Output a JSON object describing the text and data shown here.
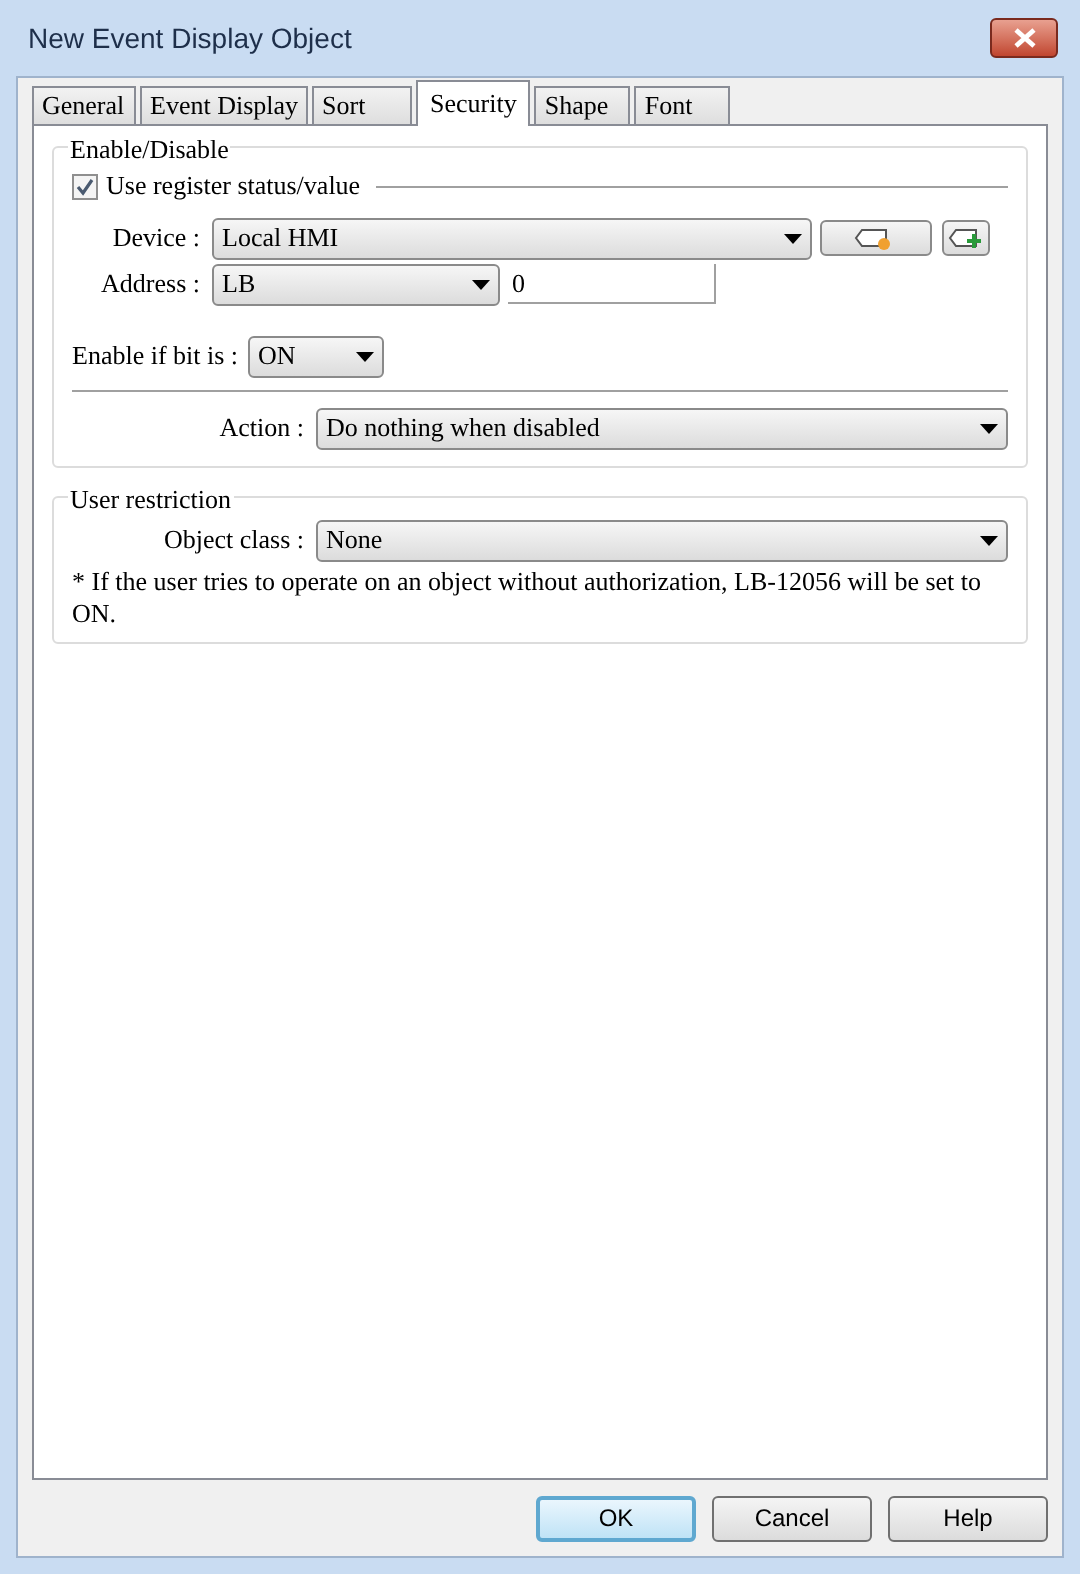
{
  "window": {
    "title": "New Event Display Object"
  },
  "tabs": [
    {
      "label": "General",
      "selected": false
    },
    {
      "label": "Event Display",
      "selected": false
    },
    {
      "label": "Sort",
      "selected": false
    },
    {
      "label": "Security",
      "selected": true
    },
    {
      "label": "Shape",
      "selected": false
    },
    {
      "label": "Font",
      "selected": false
    }
  ],
  "enable_disable": {
    "title": "Enable/Disable",
    "use_register": {
      "label": "Use register status/value",
      "checked": true
    },
    "device": {
      "label": "Device :",
      "value": "Local HMI"
    },
    "address": {
      "label": "Address :",
      "value": "LB",
      "number": "0"
    },
    "enable_if_bit": {
      "label": "Enable if bit is :",
      "value": "ON"
    },
    "action": {
      "label": "Action :",
      "value": "Do nothing when disabled"
    }
  },
  "user_restriction": {
    "title": "User restriction",
    "object_class": {
      "label": "Object class :",
      "value": "None"
    },
    "note": "* If the user tries to operate on an object without authorization, LB-12056 will be set to ON."
  },
  "buttons": [
    {
      "label": "OK",
      "default": true
    },
    {
      "label": "Cancel",
      "default": false
    },
    {
      "label": "Help",
      "default": false
    }
  ]
}
